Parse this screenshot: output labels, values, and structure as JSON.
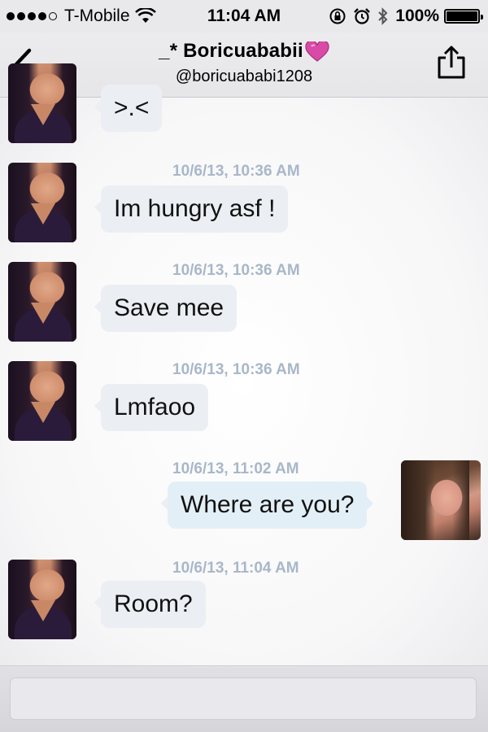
{
  "status_bar": {
    "carrier": "T-Mobile",
    "time": "11:04 AM",
    "battery_percent": "100%",
    "battery_level": 1.0,
    "signal_bars_filled": 4,
    "icons": [
      "wifi-icon",
      "rotation-lock-icon",
      "alarm-icon",
      "bluetooth-icon",
      "battery-icon"
    ]
  },
  "nav": {
    "title": "_* Boricuababii",
    "subtitle": "@boricuababi1208",
    "back_icon": "chevron-left-icon",
    "share_icon": "share-icon",
    "title_emoji": "pink-heart-icon"
  },
  "messages": [
    {
      "direction": "in",
      "text": ">.<",
      "timestamp": ""
    },
    {
      "direction": "in",
      "timestamp": "10/6/13, 10:36 AM",
      "text": "Im hungry asf !"
    },
    {
      "direction": "in",
      "timestamp": "10/6/13, 10:36 AM",
      "text": "Save mee"
    },
    {
      "direction": "in",
      "timestamp": "10/6/13, 10:36 AM",
      "text": "Lmfaoo"
    },
    {
      "direction": "out",
      "timestamp": "10/6/13, 11:02 AM",
      "text": "Where are you?"
    },
    {
      "direction": "in",
      "timestamp": "10/6/13, 11:04 AM",
      "text": "Room?"
    }
  ],
  "composer": {
    "value": "",
    "placeholder": ""
  },
  "colors": {
    "timestamp": "#a9b7c9",
    "incoming_bubble": "#ebeef2",
    "outgoing_bubble": "#e3eff6",
    "heart": "#d94aa6"
  }
}
